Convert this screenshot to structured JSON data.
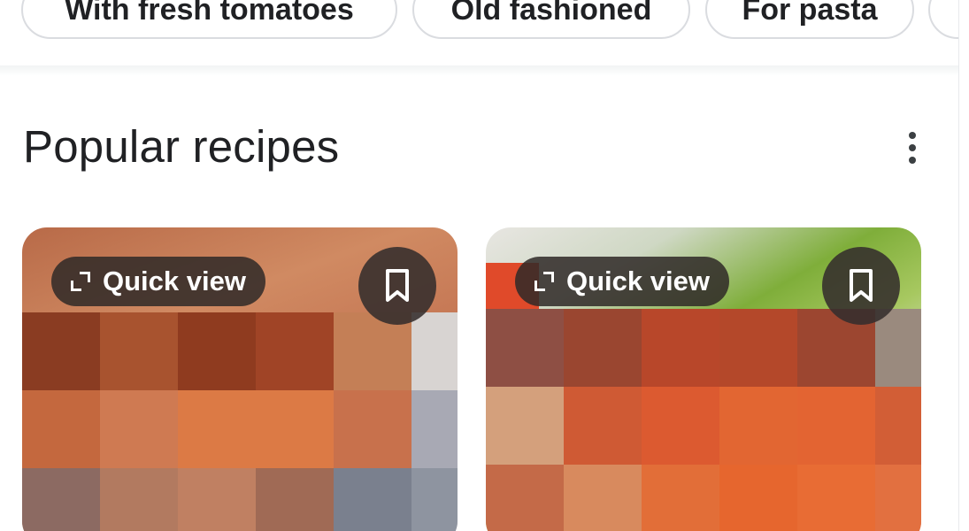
{
  "chips": [
    {
      "label": "With fresh tomatoes"
    },
    {
      "label": "Old fashioned"
    },
    {
      "label": "For pasta"
    }
  ],
  "section": {
    "title": "Popular recipes",
    "more_icon": "more-vert-icon"
  },
  "cards": [
    {
      "quick_view_label": "Quick view",
      "expand_icon": "expand-icon",
      "bookmark_icon": "bookmark-icon"
    },
    {
      "quick_view_label": "Quick view",
      "expand_icon": "expand-icon",
      "bookmark_icon": "bookmark-icon"
    }
  ],
  "colors": {
    "chip_border": "#dadce0",
    "text": "#202124",
    "overlay": "#302a28"
  }
}
